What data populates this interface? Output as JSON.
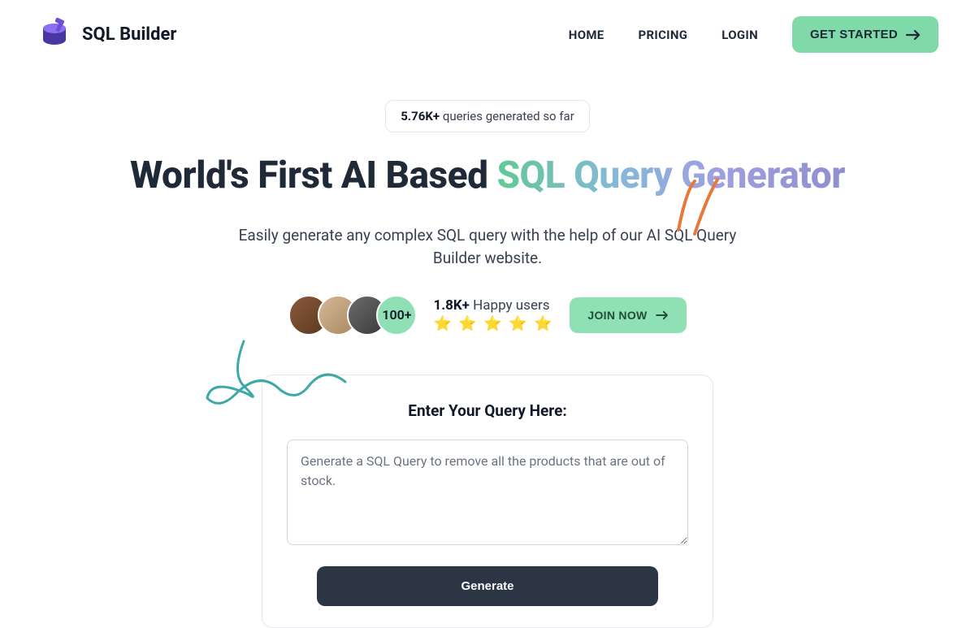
{
  "brand": "SQL Builder",
  "nav": {
    "home": "HOME",
    "pricing": "PRICING",
    "login": "LOGIN",
    "getStarted": "GET STARTED"
  },
  "badge": {
    "count": "5.76K+",
    "suffix": " queries generated so far"
  },
  "headline": {
    "plain": "World's First AI Based ",
    "gradient": "SQL Query Generator"
  },
  "subtitle": "Easily generate any complex SQL query with the help of our AI SQL Query Builder website.",
  "proof": {
    "moreLabel": "100+",
    "happyCount": "1.8K+",
    "happySuffix": " Happy users",
    "stars": "⭐ ⭐ ⭐ ⭐ ⭐",
    "joinLabel": "JOIN NOW"
  },
  "card": {
    "title": "Enter Your Query Here:",
    "placeholder": "Generate a SQL Query to remove all the products that are out of stock.",
    "generateLabel": "Generate"
  }
}
